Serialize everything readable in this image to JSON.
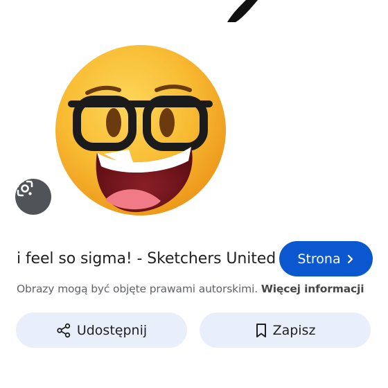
{
  "image": {
    "subject_icon": "nerd-face-emoji"
  },
  "lens": {
    "icon": "google-lens-icon"
  },
  "result": {
    "title": "i feel so sigma! - Sketchers United",
    "visit_label": "Strona",
    "visit_icon": "chevron-right-icon"
  },
  "notice": {
    "text": "Obrazy mogą być objęte prawami autorskimi.",
    "link_label": "Więcej informacji"
  },
  "actions": {
    "share_label": "Udostępnij",
    "share_icon": "share-icon",
    "save_label": "Zapisz",
    "save_icon": "bookmark-icon"
  },
  "colors": {
    "accent": "#0b57d0",
    "action_bg": "#e8effb",
    "emoji_yellow": "#f7b52a"
  }
}
